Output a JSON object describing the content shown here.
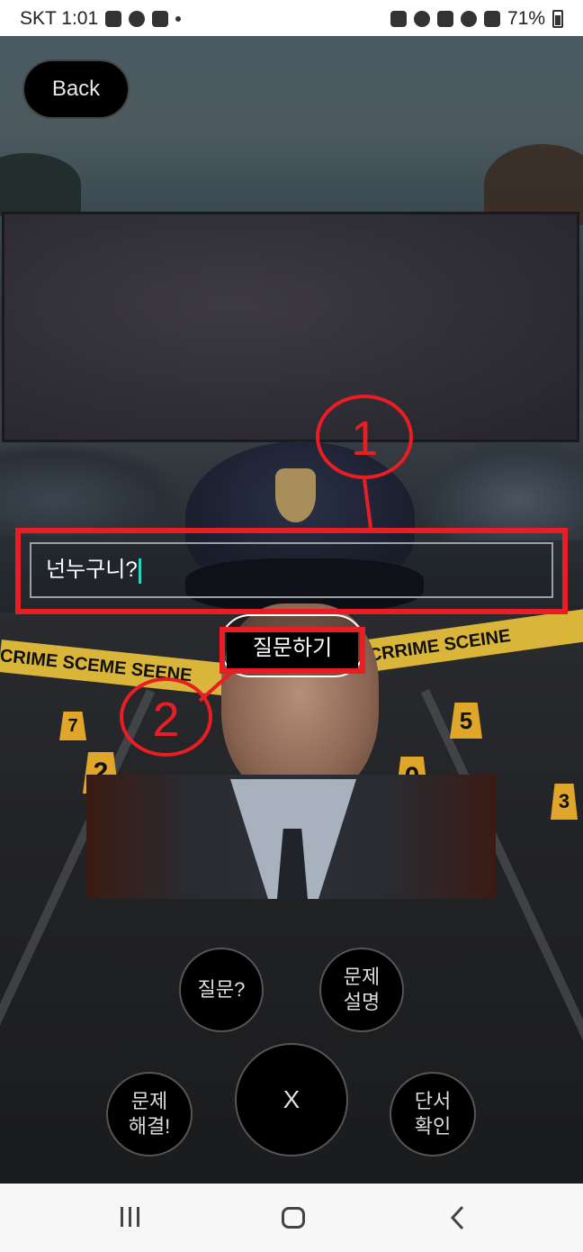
{
  "status_bar": {
    "carrier_time": "SKT 1:01",
    "battery": "71%",
    "left_icons": [
      "image-icon",
      "kakaotalk-icon",
      "youtube-icon",
      "dot-icon"
    ],
    "right_icons": [
      "lock-icon",
      "alarm-icon",
      "mute-icon",
      "wifi-icon",
      "signal-icon",
      "battery-icon"
    ]
  },
  "header": {
    "back_label": "Back"
  },
  "question": {
    "input_value": "넌누구니?",
    "ask_label": "질문하기"
  },
  "scene": {
    "tape_text_left": "CRIME SCEME SEENE",
    "tape_text_right": "CRRIME SCEINE",
    "markers": [
      "7",
      "2",
      "5",
      "5",
      "3",
      "0"
    ]
  },
  "annotations": {
    "callout_1": "1",
    "callout_2": "2",
    "color": "#ea1c24"
  },
  "controls": {
    "question_hint": "질문?",
    "problem_desc": "문제\n설명",
    "close": "X",
    "solve": "문제\n해결!",
    "clues": "단서\n확인"
  },
  "nav": {
    "recents": "recents-icon",
    "home": "home-icon",
    "back": "back-icon"
  }
}
